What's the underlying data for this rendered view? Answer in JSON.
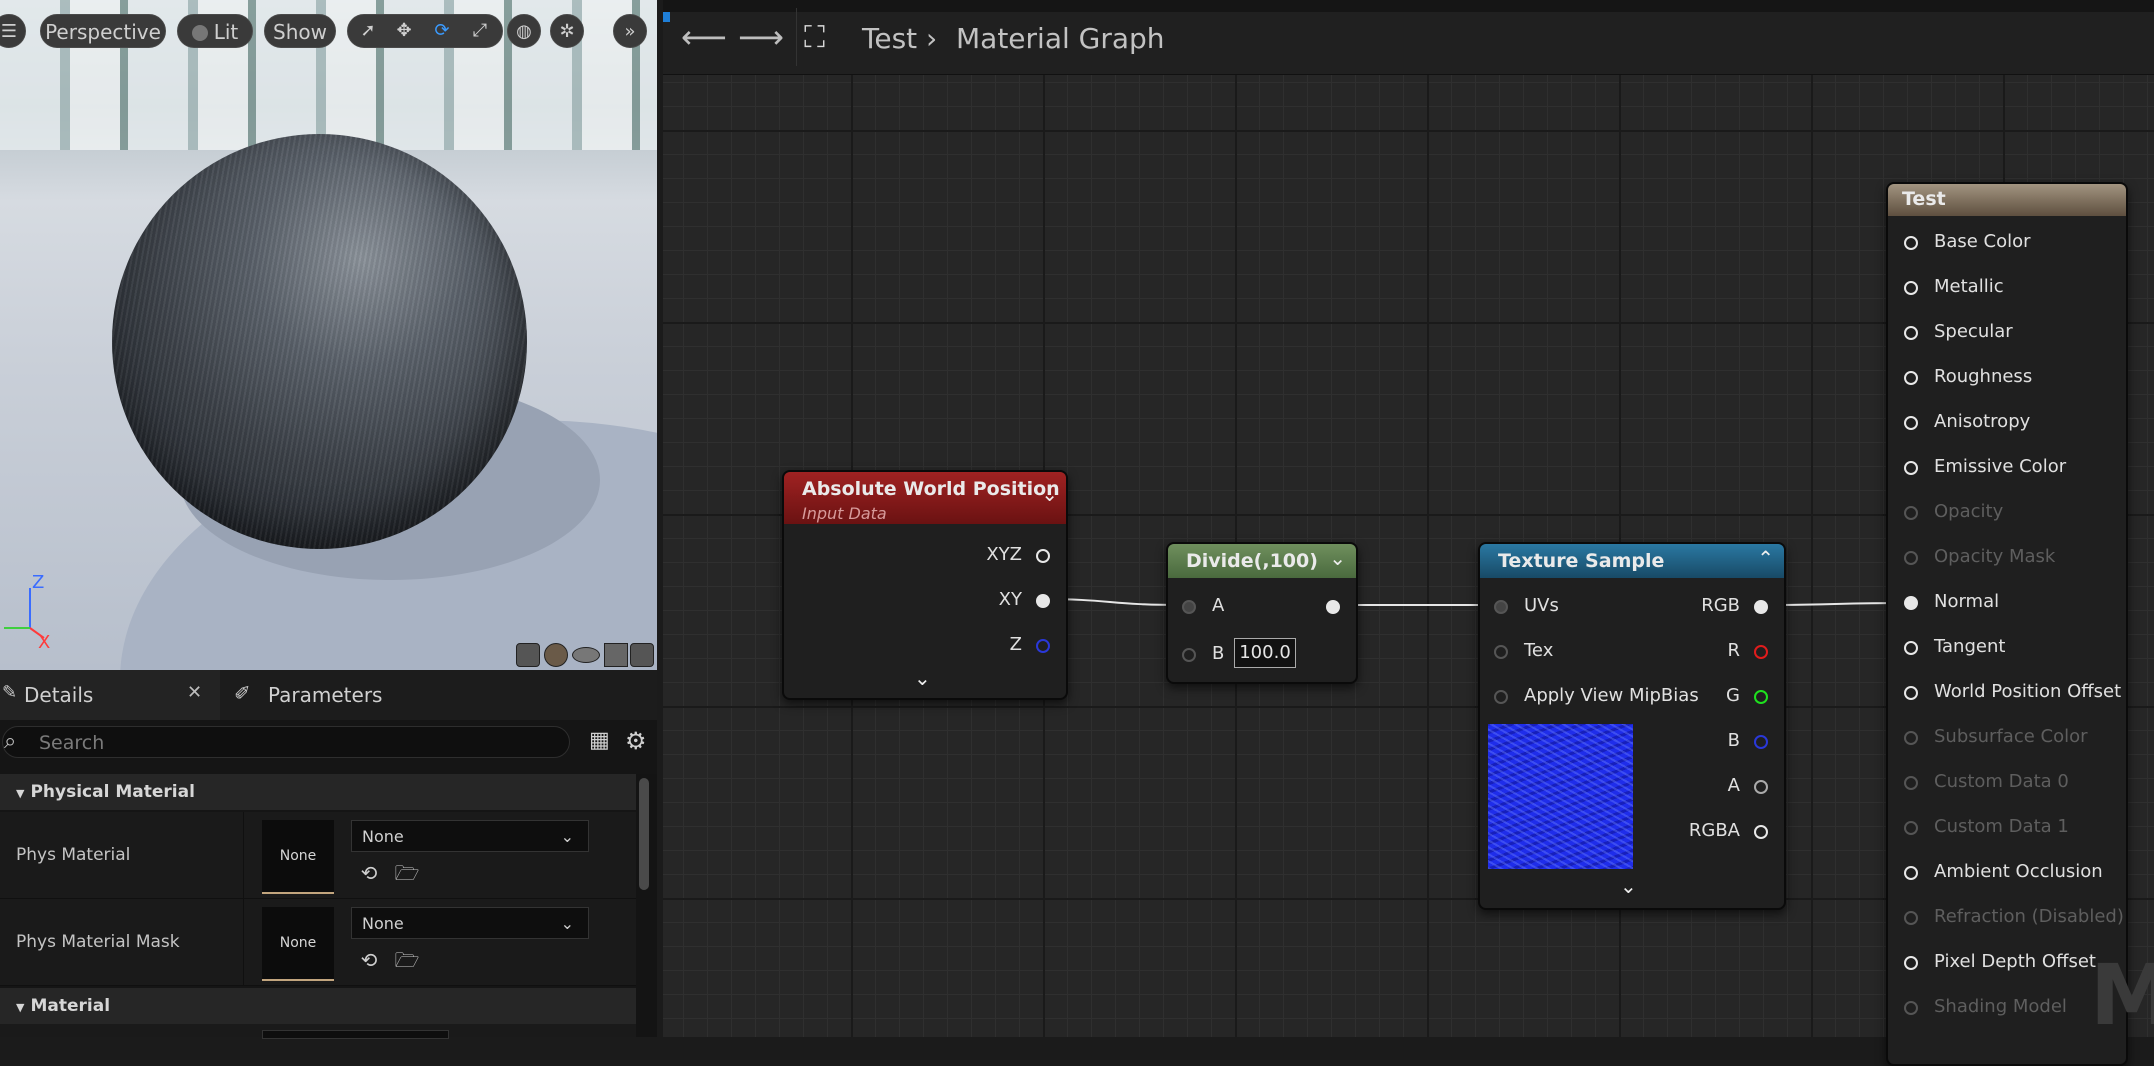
{
  "viewport": {
    "menu_icon": "menu-icon",
    "perspective_label": "Perspective",
    "lit_label": "Lit",
    "show_label": "Show",
    "tools": [
      "select-icon",
      "translate-icon",
      "rotate-icon",
      "scale-icon"
    ],
    "axis": {
      "z": "Z",
      "x": "X"
    }
  },
  "details": {
    "tabs": [
      {
        "label": "Details"
      },
      {
        "label": "Parameters"
      }
    ],
    "search_placeholder": "Search",
    "sections": [
      {
        "title": "Physical Material",
        "rows": [
          {
            "label": "Phys Material",
            "thumb": "None",
            "value": "None"
          },
          {
            "label": "Phys Material Mask",
            "thumb": "None",
            "value": "None"
          }
        ]
      },
      {
        "title": "Material"
      }
    ]
  },
  "graph": {
    "breadcrumb": {
      "root": "Test",
      "current": "Material Graph"
    },
    "watermark": "M",
    "nodes": {
      "awp": {
        "title": "Absolute World Position",
        "subtitle": "Input Data",
        "outputs": [
          "XYZ",
          "XY",
          "Z"
        ]
      },
      "divide": {
        "title": "Divide(,100)",
        "input_a": "A",
        "input_b": "B",
        "b_value": "100.0"
      },
      "texture": {
        "title": "Texture Sample",
        "inputs": [
          "UVs",
          "Tex",
          "Apply View MipBias"
        ],
        "outputs": [
          "RGB",
          "R",
          "G",
          "B",
          "A",
          "RGBA"
        ]
      },
      "result": {
        "title": "Test",
        "pins": [
          {
            "label": "Base Color",
            "enabled": true
          },
          {
            "label": "Metallic",
            "enabled": true
          },
          {
            "label": "Specular",
            "enabled": true
          },
          {
            "label": "Roughness",
            "enabled": true
          },
          {
            "label": "Anisotropy",
            "enabled": true
          },
          {
            "label": "Emissive Color",
            "enabled": true
          },
          {
            "label": "Opacity",
            "enabled": false
          },
          {
            "label": "Opacity Mask",
            "enabled": false
          },
          {
            "label": "Normal",
            "enabled": true,
            "connected": true
          },
          {
            "label": "Tangent",
            "enabled": true
          },
          {
            "label": "World Position Offset",
            "enabled": true
          },
          {
            "label": "Subsurface Color",
            "enabled": false
          },
          {
            "label": "Custom Data 0",
            "enabled": false
          },
          {
            "label": "Custom Data 1",
            "enabled": false
          },
          {
            "label": "Ambient Occlusion",
            "enabled": true
          },
          {
            "label": "Refraction (Disabled)",
            "enabled": false
          },
          {
            "label": "Pixel Depth Offset",
            "enabled": true
          },
          {
            "label": "Shading Model",
            "enabled": false
          }
        ]
      }
    },
    "colors": {
      "awp_header": "#8a1a1a",
      "divide_header": "#5c7a4c",
      "texture_header": "#1f5d7e",
      "result_header": "#7a6a58"
    }
  }
}
